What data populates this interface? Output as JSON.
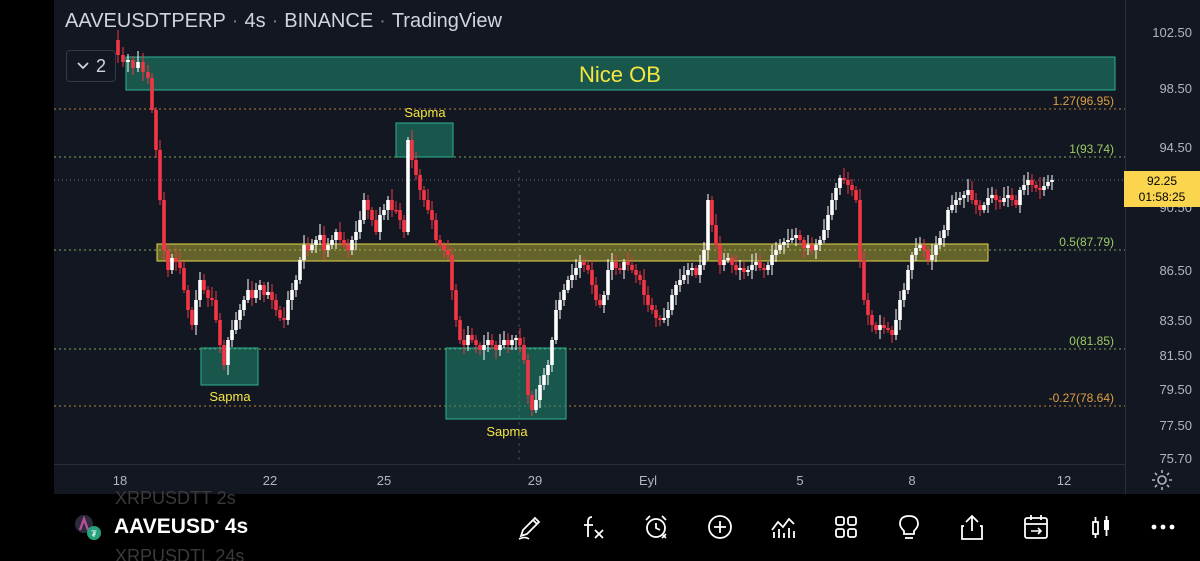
{
  "header": {
    "symbol": "AAVEUSDTPERP",
    "interval": "4s",
    "exchange": "BINANCE",
    "source": "TradingView",
    "legend_count": "2"
  },
  "annotations": {
    "ob_label": "Nice OB",
    "sapma_top": "Sapma",
    "sapma_left": "Sapma",
    "sapma_bottom": "Sapma"
  },
  "fib_levels": [
    {
      "label": "1.27(96.95)",
      "price": 96.95,
      "color": "#e0a040"
    },
    {
      "label": "1(93.74)",
      "price": 93.74,
      "color": "#9ccc65"
    },
    {
      "label": "0.5(87.79)",
      "price": 87.79,
      "color": "#9ccc65"
    },
    {
      "label": "0(81.85)",
      "price": 81.85,
      "color": "#9ccc65"
    },
    {
      "label": "-0.27(78.64)",
      "price": 78.64,
      "color": "#e0a040"
    }
  ],
  "price_axis": {
    "ticks": [
      "102.50",
      "98.50",
      "94.50",
      "90.50",
      "86.50",
      "83.50",
      "81.50",
      "79.50",
      "77.50",
      "75.70"
    ],
    "current_price": "92.25",
    "countdown": "01:58:25"
  },
  "time_axis": {
    "ticks": [
      "18",
      "22",
      "25",
      "29",
      "Eyl",
      "5",
      "8",
      "12"
    ]
  },
  "bottom_bar": {
    "ghost_top": "XRPUSDTT 2s",
    "symbol": "AAVEUSD",
    "symbol_mark": "•",
    "interval": "4s",
    "ghost_bottom": "XRPUSDTL 24s"
  },
  "colors": {
    "background": "#131722",
    "bull": "#ffffff",
    "bear": "#f23645",
    "zone_green": "#1f8a70",
    "zone_yellow": "#c8c03a",
    "fib_line": "#9ccc65",
    "text_yellow": "#f5e642"
  },
  "icons": [
    "pen-icon",
    "fx-icon",
    "alarm-icon",
    "plus-icon",
    "indicators-icon",
    "layout-grid-icon",
    "lightbulb-icon",
    "share-icon",
    "calendar-icon",
    "candle-icon",
    "more-icon",
    "gear-icon"
  ]
}
